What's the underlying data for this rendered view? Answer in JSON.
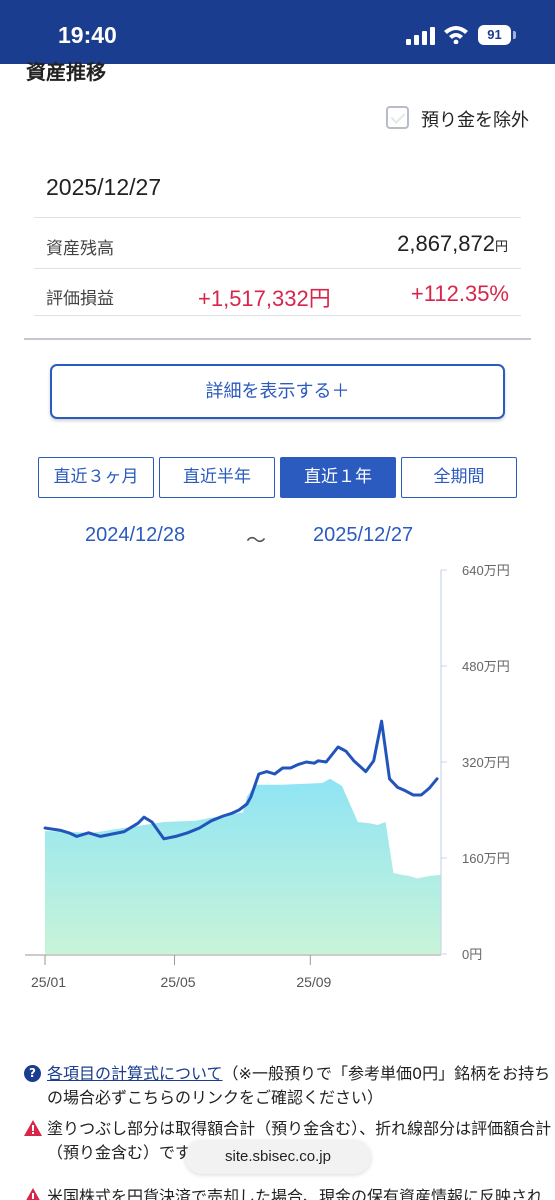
{
  "status_bar": {
    "time": "19:40",
    "battery": "91"
  },
  "section_title": "資産推移",
  "exclude_deposit_label": "預り金を除外",
  "summary": {
    "date": "2025/12/27",
    "balance_label": "資産残高",
    "balance_value": "2,867,872",
    "balance_unit": "円",
    "pl_label": "評価損益",
    "pl_value": "+1,517,332円",
    "pl_rate": "+112.35%"
  },
  "detail_button": "詳細を表示する＋",
  "period_tabs": [
    {
      "label": "直近３ヶ月",
      "active": false
    },
    {
      "label": "直近半年",
      "active": false
    },
    {
      "label": "直近１年",
      "active": true
    },
    {
      "label": "全期間",
      "active": false
    }
  ],
  "range": {
    "start": "2024/12/28",
    "separator": "〜",
    "end": "2025/12/27"
  },
  "chart_data": {
    "type": "line+area",
    "y_tick_labels": [
      "640万円",
      "480万円",
      "320万円",
      "160万円",
      "0円"
    ],
    "y_ticks": [
      640,
      480,
      320,
      160,
      0
    ],
    "ylim": [
      0,
      640
    ],
    "y_unit": "万円",
    "x_tick_labels": [
      "25/01",
      "25/05",
      "25/09"
    ],
    "x_ticks": [
      0.0,
      0.327,
      0.67
    ],
    "xlim": [
      0,
      1
    ],
    "series": [
      {
        "role": "line",
        "color": "#2255bb",
        "x": [
          0.0,
          0.04,
          0.06,
          0.08,
          0.11,
          0.14,
          0.17,
          0.2,
          0.22,
          0.235,
          0.25,
          0.27,
          0.3,
          0.33,
          0.36,
          0.39,
          0.42,
          0.45,
          0.47,
          0.49,
          0.51,
          0.52,
          0.54,
          0.56,
          0.58,
          0.6,
          0.62,
          0.64,
          0.66,
          0.68,
          0.69,
          0.71,
          0.74,
          0.76,
          0.78,
          0.8,
          0.81,
          0.83,
          0.85,
          0.87,
          0.89,
          0.91,
          0.93,
          0.95,
          0.97,
          0.99
        ],
        "values": [
          210,
          206,
          202,
          196,
          202,
          196,
          200,
          204,
          212,
          218,
          228,
          220,
          192,
          196,
          202,
          210,
          222,
          230,
          234,
          240,
          250,
          262,
          300,
          304,
          300,
          310,
          310,
          316,
          320,
          318,
          322,
          320,
          345,
          338,
          322,
          310,
          304,
          322,
          388,
          292,
          278,
          272,
          265,
          265,
          276,
          292
        ]
      },
      {
        "role": "area",
        "color_top": "#8fe4f4",
        "color_bottom": "#c8f4d8",
        "x": [
          0.0,
          0.12,
          0.3,
          0.38,
          0.46,
          0.5,
          0.51,
          0.53,
          0.6,
          0.7,
          0.72,
          0.75,
          0.79,
          0.82,
          0.84,
          0.86,
          0.88,
          0.9,
          0.92,
          0.94,
          0.97,
          1.0
        ],
        "values": [
          205,
          202,
          220,
          222,
          232,
          236,
          262,
          282,
          282,
          285,
          292,
          280,
          220,
          218,
          215,
          220,
          135,
          132,
          130,
          126,
          130,
          132
        ]
      }
    ]
  },
  "notes": [
    {
      "icon": "help-icon",
      "link_text": "各項目の計算式について",
      "text": "（※一般預りで「参考単価0円」銘柄をお持ちの場合必ずこちらのリンクをご確認ください）"
    },
    {
      "icon": "warning-icon",
      "text": "塗りつぶし部分は取得額合計（預り金含む）、折れ線部分は評価額合計（預り金含む）です。"
    },
    {
      "icon": "warning-icon",
      "text": "米国株式を円貨決済で売却した場合、現金の保有資産情報に反映されます。"
    }
  ],
  "url_pill": "site.sbisec.co.jp",
  "colors": {
    "header": "#1b3d8f",
    "accent": "#2b5bbf",
    "profit": "#d8264b"
  }
}
